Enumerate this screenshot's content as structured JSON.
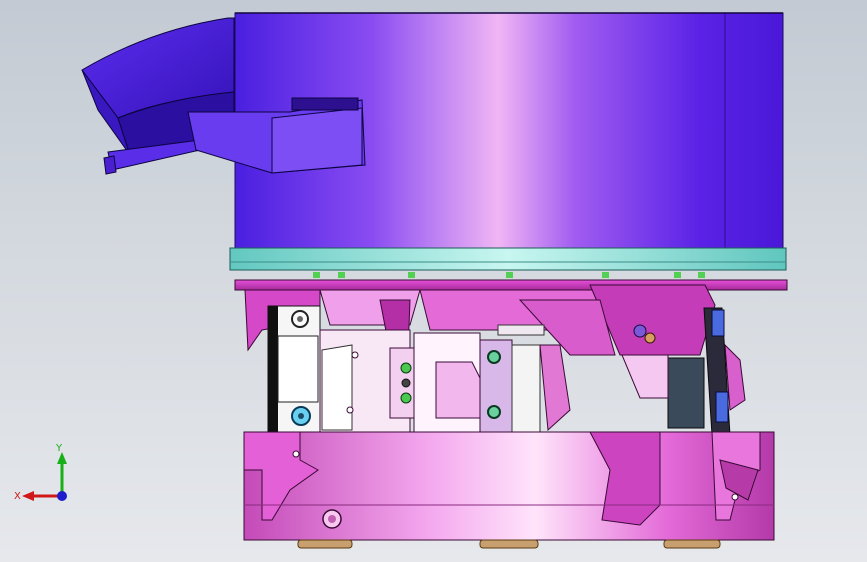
{
  "viewport": {
    "background_top": "#c3cad3",
    "background_bottom": "#e6e8ec"
  },
  "model": {
    "bowl_color": "#6a2cf0",
    "plate_color": "#7fe3d6",
    "body_color": "#e85ad6",
    "accent_color": "#ff9be8"
  },
  "triad": {
    "x_label": "X",
    "y_label": "Y",
    "z_color": "#1d1dcc",
    "x_color": "#d01818",
    "y_color": "#18b018"
  }
}
